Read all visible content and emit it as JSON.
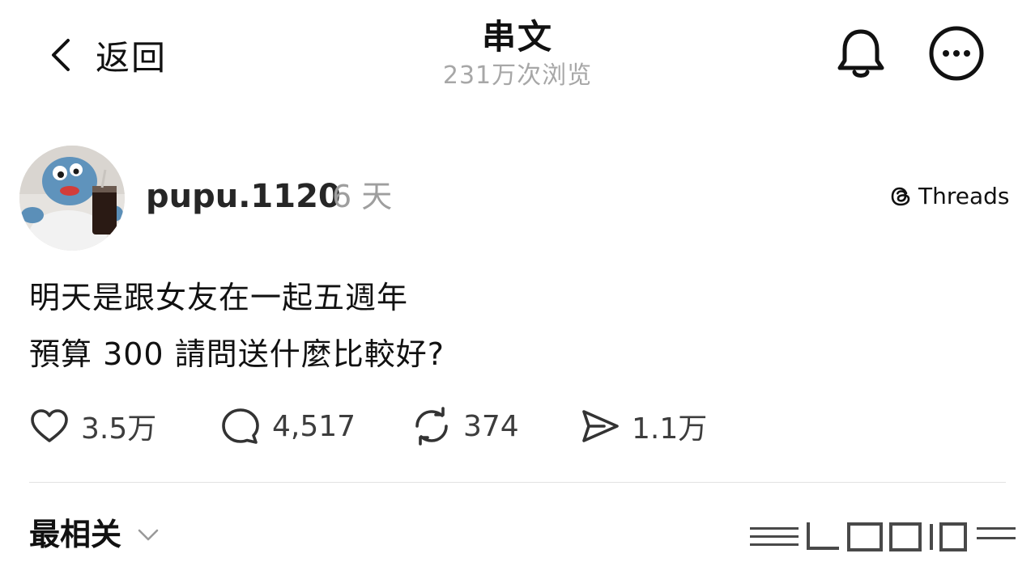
{
  "header": {
    "back_label": "返回",
    "title": "串文",
    "subtitle": "231万次浏览",
    "icons": [
      "chevron-left-icon",
      "bell-icon",
      "more-icon"
    ]
  },
  "post": {
    "username": "pupu.1120",
    "time": "6 天",
    "brand": "Threads",
    "body_lines": [
      "明天是跟女友在一起五週年",
      "預算 300 請問送什麼比較好?"
    ],
    "actions": {
      "likes": "3.5万",
      "replies": "4,517",
      "reposts": "374",
      "shares": "1.1万"
    }
  },
  "sort": {
    "label": "最相关",
    "icon": "chevron-down-icon"
  },
  "colors": {
    "text": "#111111",
    "muted": "#a7a7a7",
    "divider": "#e3e3e3",
    "background": "#ffffff"
  }
}
